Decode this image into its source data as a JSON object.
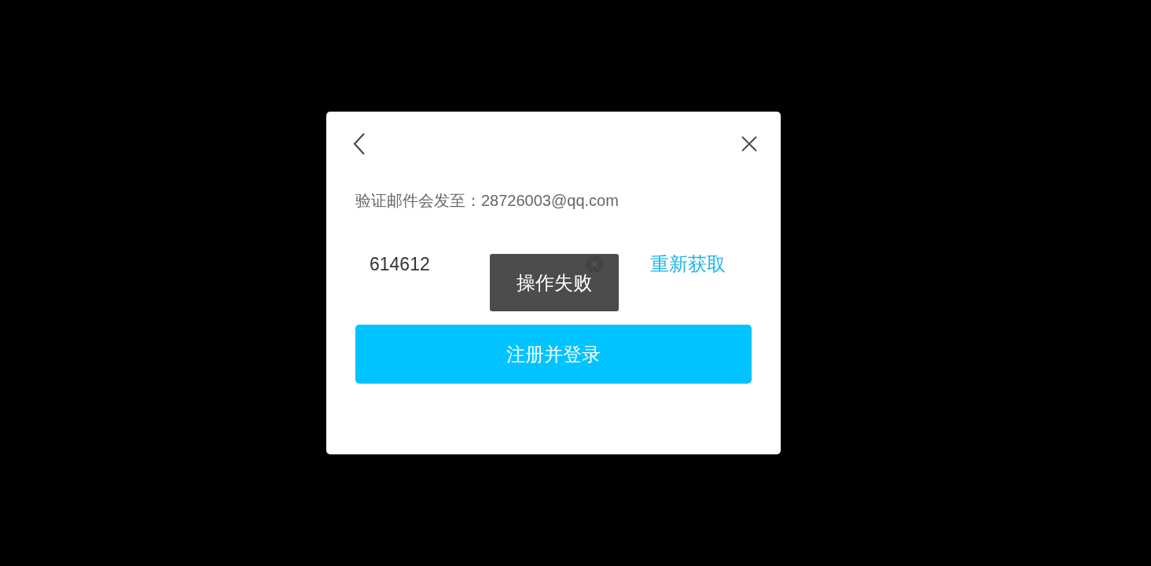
{
  "dialog": {
    "notice": "验证邮件会发至：28726003@qq.com",
    "code_field": {
      "value": "614612"
    },
    "resend_link": "重新获取",
    "submit_button": "注册并登录"
  },
  "toast": {
    "message": "操作失败"
  }
}
